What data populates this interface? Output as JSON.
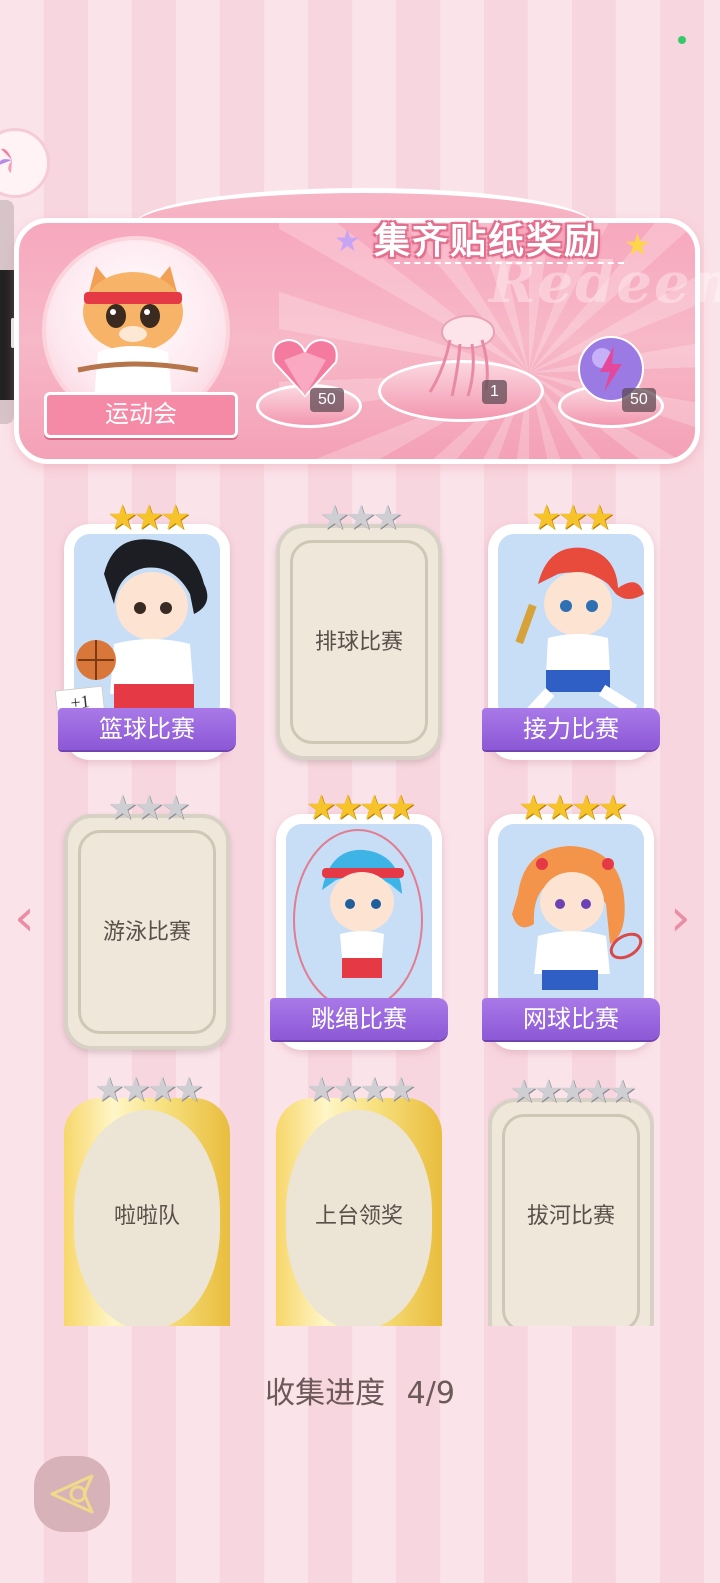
{
  "banner": {
    "title": "集齐贴纸奖励",
    "watermark": "Redeem",
    "event_label": "运动会",
    "rewards": [
      {
        "icon": "pink-heart-gem-icon",
        "count": "50"
      },
      {
        "icon": "jellyfish-ribbon-icon",
        "count": "1"
      },
      {
        "icon": "purple-lightning-orb-icon",
        "count": "50"
      }
    ]
  },
  "cards": [
    {
      "name": "篮球比赛",
      "stars_filled": 3,
      "stars_total": 3,
      "unlocked": true,
      "badge": "+1"
    },
    {
      "name": "排球比赛",
      "stars_filled": 0,
      "stars_total": 3,
      "unlocked": false
    },
    {
      "name": "接力比赛",
      "stars_filled": 3,
      "stars_total": 3,
      "unlocked": true
    },
    {
      "name": "游泳比赛",
      "stars_filled": 0,
      "stars_total": 3,
      "unlocked": false
    },
    {
      "name": "跳绳比赛",
      "stars_filled": 4,
      "stars_total": 4,
      "unlocked": true
    },
    {
      "name": "网球比赛",
      "stars_filled": 4,
      "stars_total": 4,
      "unlocked": true
    },
    {
      "name": "啦啦队",
      "stars_filled": 0,
      "stars_total": 4,
      "unlocked": false
    },
    {
      "name": "上台领奖",
      "stars_filled": 0,
      "stars_total": 4,
      "unlocked": false
    },
    {
      "name": "拔河比赛",
      "stars_filled": 0,
      "stars_total": 5,
      "unlocked": false
    }
  ],
  "progress": {
    "label": "收集进度",
    "value": "4/9"
  },
  "colors": {
    "accent_pink": "#f58aa7",
    "label_purple": "#8c58d6",
    "star_gold": "#f6c32b"
  }
}
